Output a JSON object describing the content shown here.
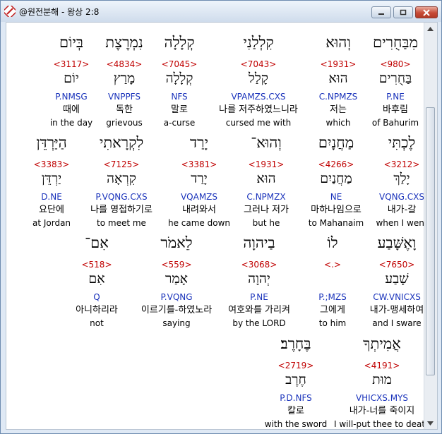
{
  "window": {
    "title": "@원전분해 - 왕상 2:8"
  },
  "words": [
    {
      "heb": "מִבַּחֻרִים",
      "code": "<980>",
      "lemma": "בַּחֻרִים",
      "parse": "P.NE",
      "ko": "바후림",
      "en": "of Bahurim"
    },
    {
      "heb": "וְהוּא",
      "code": "<1931>",
      "lemma": "הוּא",
      "parse": "C.NPMZS",
      "ko": "저는",
      "en": "which"
    },
    {
      "heb": "קִלְלַנִי",
      "code": "<7043>",
      "lemma": "קָלַל",
      "parse": "VPAMZS.CXS",
      "ko": "나를 저주하였느니라",
      "en": "cursed me with"
    },
    {
      "heb": "קְלָלָה",
      "code": "<7045>",
      "lemma": "קְלָלָה",
      "parse": "NFS",
      "ko": "말로",
      "en": "a-curse"
    },
    {
      "heb": "נִמְרֶצֶת",
      "code": "<4834>",
      "lemma": "מָרַץ",
      "parse": "VNPPFS",
      "ko": "독한",
      "en": "grievous"
    },
    {
      "heb": "בְּיוֹם",
      "code": "<3117>",
      "lemma": "יוֹם",
      "parse": "P.NMSG",
      "ko": "때에",
      "en": "in the day"
    },
    {
      "heb": "לֶכְתִּי",
      "code": "<3212>",
      "lemma": "יָלַךְ",
      "parse": "VQNG.CXS",
      "ko": "내가-갈",
      "en": "when I went"
    },
    {
      "heb": "מַחֲנָיִם",
      "code": "<4266>",
      "lemma": "מַחֲנַיִם",
      "parse": "NE",
      "ko": "마하나임으로",
      "en": "to Mahanaim"
    },
    {
      "heb": "וְהוּא־",
      "code": "<1931>",
      "lemma": "הוּא",
      "parse": "C.NPMZX",
      "ko": "그러나 저가",
      "en": "but he"
    },
    {
      "heb": "יָרַד",
      "code": "<3381>",
      "lemma": "יָרַד",
      "parse": "VQAMZS",
      "ko": "내려와서",
      "en": "he came down"
    },
    {
      "heb": "לִקְרָאתִי",
      "code": "<7125>",
      "lemma": "קִרְאָה",
      "parse": "P.VQNG.CXS",
      "ko": "나를 영접하기로",
      "en": "to meet me"
    },
    {
      "heb": "הַיַּרְדֵּן",
      "code": "<3383>",
      "lemma": "יַרְדֵּן",
      "parse": "D.NE",
      "ko": "요단에",
      "en": "at Jordan"
    },
    {
      "heb": "וָאֶשָּׁבַע",
      "code": "<7650>",
      "lemma": "שָׁבַע",
      "parse": "CW.VNICXS",
      "ko": "내가-맹세하여",
      "en": "and I sware"
    },
    {
      "heb": "לוֹ",
      "code": "<.>",
      "lemma": "",
      "parse": "P.;MZS",
      "ko": "그에게",
      "en": "to him"
    },
    {
      "heb": "בַיהוָה",
      "code": "<3068>",
      "lemma": "יְהוָה",
      "parse": "P.NE",
      "ko": "여호와를 가리켜",
      "en": "by the LORD"
    },
    {
      "heb": "לֵאמֹר",
      "code": "<559>",
      "lemma": "אָמַר",
      "parse": "P.VQNG",
      "ko": "이르기를-하였노라",
      "en": "saying"
    },
    {
      "heb": "אִם־",
      "code": "<518>",
      "lemma": "אִם",
      "parse": "Q",
      "ko": "아니하리라",
      "en": "not"
    },
    {
      "heb": "אֲמִיתְךָ",
      "code": "<4191>",
      "lemma": "מוּת",
      "parse": "VHICXS.MYS",
      "ko": "내가-너를 죽이지",
      "en": "I will-put thee to death"
    },
    {
      "heb": "בֶּחָרֶב׃",
      "code": "<2719>",
      "lemma": "חֶרֶב",
      "parse": "P.D.NFS",
      "ko": "칼로",
      "en": "with the sword"
    }
  ]
}
